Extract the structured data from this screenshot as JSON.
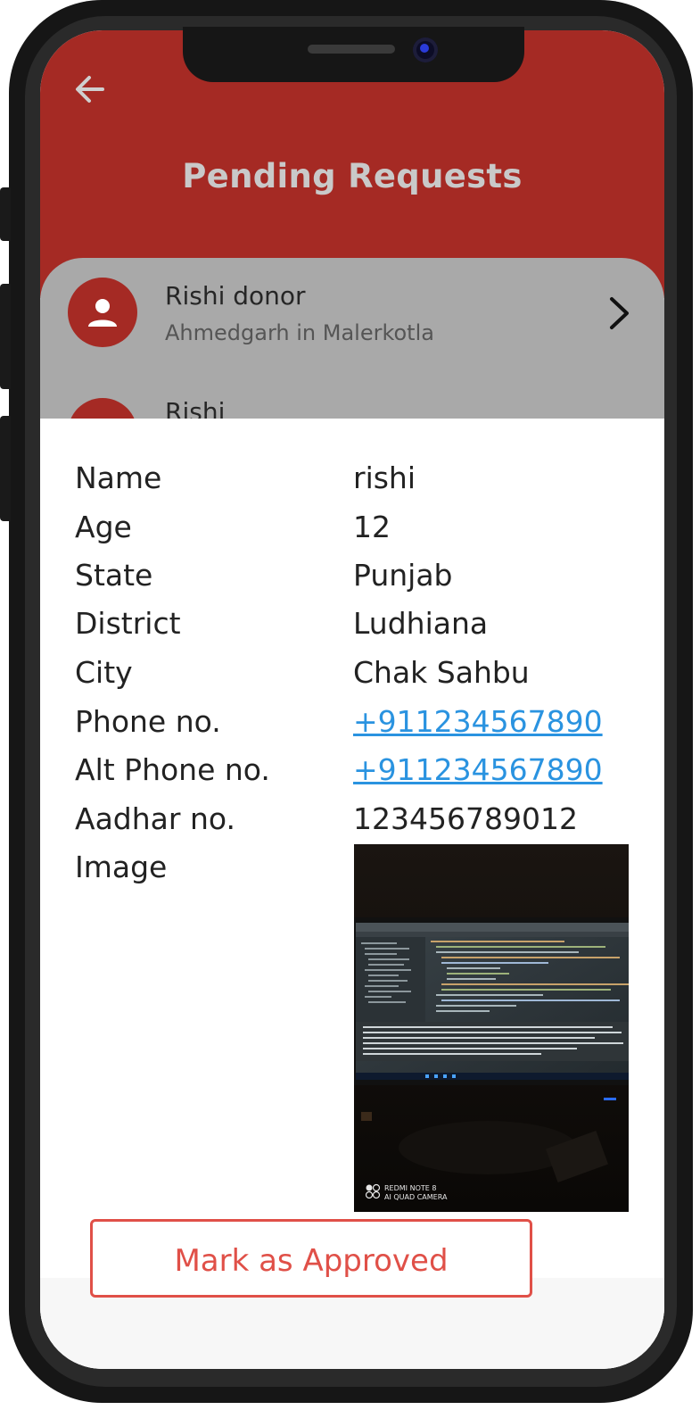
{
  "header": {
    "title": "Pending Requests",
    "back_icon": "arrow-left-icon"
  },
  "requests": [
    {
      "name": "Rishi donor",
      "location": "Ahmedgarh in Malerkotla"
    },
    {
      "name": "Rishi",
      "location": ""
    }
  ],
  "details": {
    "fields": [
      {
        "label": "Name",
        "value": "rishi"
      },
      {
        "label": "Age",
        "value": "12"
      },
      {
        "label": "State",
        "value": "Punjab"
      },
      {
        "label": "District",
        "value": "Ludhiana"
      },
      {
        "label": "City",
        "value": "Chak Sahbu"
      },
      {
        "label": "Phone no.",
        "value": "+911234567890"
      },
      {
        "label": "Alt Phone no.",
        "value": "+911234567890"
      },
      {
        "label": "Aadhar no.",
        "value": "123456789012"
      },
      {
        "label": "Image",
        "value": ""
      }
    ],
    "photo_watermark": [
      "REDMI NOTE 8",
      "AI QUAD CAMERA"
    ]
  },
  "actions": {
    "approve_label": "Mark as Approved"
  },
  "colors": {
    "primary": "#a52a24",
    "accent": "#e05048",
    "link": "#2a93e0"
  }
}
